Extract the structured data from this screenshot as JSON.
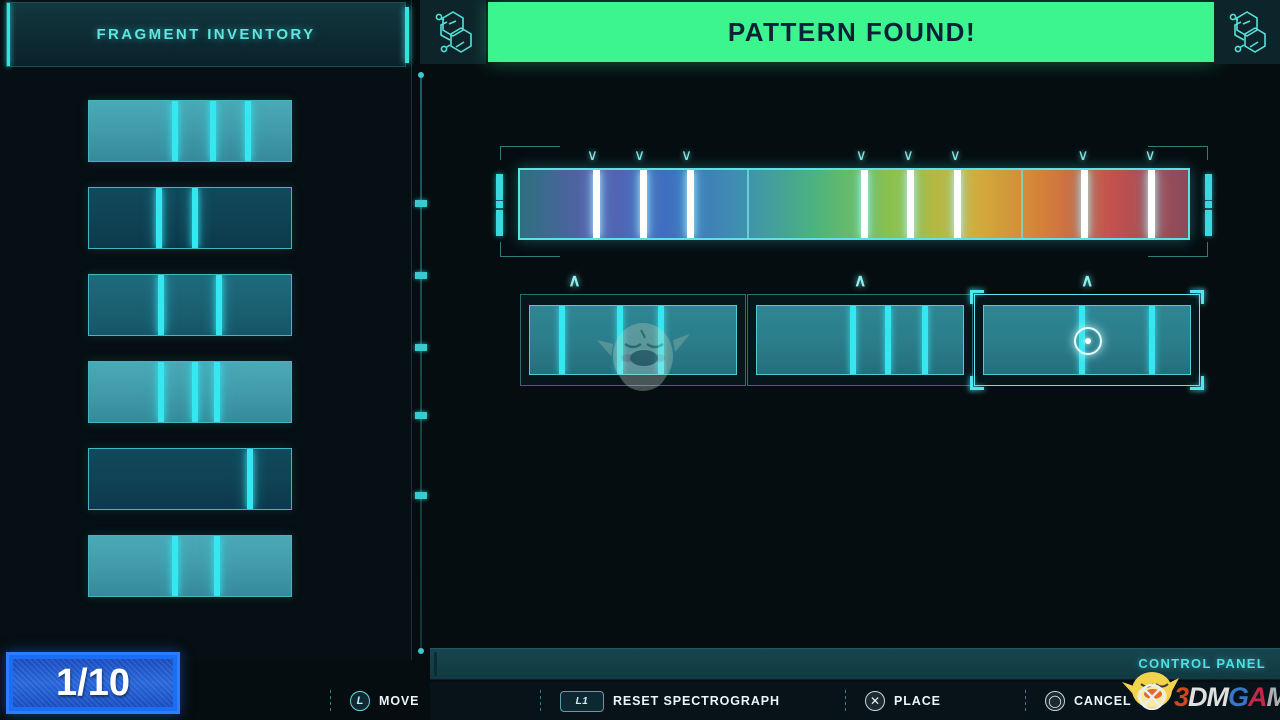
{
  "inventory": {
    "title": "FRAGMENT INVENTORY",
    "fragments": [
      {
        "id": "fragment-1",
        "brightness": "bright",
        "lines": [
          41,
          60,
          77
        ]
      },
      {
        "id": "fragment-2",
        "brightness": "dark",
        "lines": [
          33,
          51
        ]
      },
      {
        "id": "fragment-3",
        "brightness": "mid",
        "lines": [
          34,
          63
        ]
      },
      {
        "id": "fragment-4",
        "brightness": "bright",
        "lines": [
          34,
          51,
          62
        ]
      },
      {
        "id": "fragment-5",
        "brightness": "dark",
        "lines": [
          78
        ]
      },
      {
        "id": "fragment-6",
        "brightness": "bright",
        "lines": [
          41,
          62
        ]
      }
    ]
  },
  "counter": {
    "label": "1/10"
  },
  "banner": {
    "message": "PATTERN FOUND!",
    "icon_left": "molecule-hexagon-icon",
    "icon_right": "molecule-hexagon-icon",
    "color": "#3cf58f"
  },
  "spectrograph": {
    "name": "main-spectrograph",
    "spectral_lines": [
      11,
      18,
      25,
      51,
      58,
      65,
      84,
      94
    ],
    "dividers": [
      34,
      75
    ],
    "markers": [
      11,
      18,
      25,
      51,
      58,
      65,
      84,
      94
    ],
    "gradient_stops": [
      "#2d6f7e",
      "#5a5fae",
      "#3f6fc0",
      "#3f8fb0",
      "#4ab37f",
      "#8fc24a",
      "#d1b23c",
      "#d4813a",
      "#c2504f",
      "#8a4a5c"
    ]
  },
  "slots": [
    {
      "id": "slot-1",
      "selected": false,
      "lines": [
        14,
        42,
        62
      ],
      "marker": 24
    },
    {
      "id": "slot-2",
      "selected": false,
      "lines": [
        45,
        62,
        80
      ],
      "marker": 50
    },
    {
      "id": "slot-3",
      "selected": true,
      "lines": [
        46,
        80
      ],
      "marker": 50,
      "cursor": 50
    }
  ],
  "control_panel": {
    "label": "CONTROL PANEL"
  },
  "hints": [
    {
      "id": "hint-move",
      "button": "L",
      "button_type": "stick",
      "label": "MOVE"
    },
    {
      "id": "hint-reset",
      "button": "L1",
      "button_type": "shoulder",
      "label": "RESET SPECTROGRAPH"
    },
    {
      "id": "hint-place",
      "button": "✕",
      "button_type": "face",
      "label": "PLACE"
    },
    {
      "id": "hint-cancel",
      "button": "◯",
      "button_type": "face",
      "label": "CANCEL"
    }
  ],
  "watermark": {
    "brand_part1": "3",
    "brand_part2": "DM",
    "brand_part3": "G",
    "brand_part4": "A",
    "brand_part5": "ME",
    "mascot": "chick-mascot-icon"
  }
}
